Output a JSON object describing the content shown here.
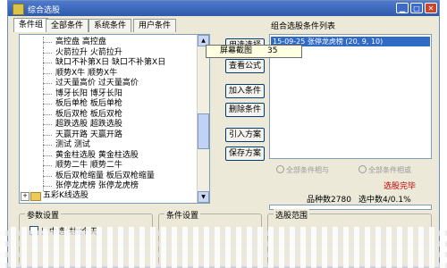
{
  "window": {
    "title": "综合选股"
  },
  "tabs": [
    {
      "label": "条件组",
      "active": true
    },
    {
      "label": "全部条件",
      "active": false
    },
    {
      "label": "系统条件",
      "active": false
    },
    {
      "label": "用户条件",
      "active": false
    }
  ],
  "tree": {
    "items": [
      {
        "label": "高控盘  高控盘"
      },
      {
        "label": "火箭拉升  火箭拉升"
      },
      {
        "label": "缺口不补第X日  缺口不补第X日"
      },
      {
        "label": "顺势X牛  顺势X牛"
      },
      {
        "label": "过天量高价  过天量高价"
      },
      {
        "label": "博牙长阳  博牙长阳"
      },
      {
        "label": "板后单枪  板后单枪"
      },
      {
        "label": "板后双枪  板后双枪"
      },
      {
        "label": "超跌选股  超跌选股"
      },
      {
        "label": "天赢开路  天赢开路"
      },
      {
        "label": "测试  测试"
      },
      {
        "label": "黄金柱选股  黄金柱选股"
      },
      {
        "label": "顺势二牛  顺势二牛"
      },
      {
        "label": "板后双枪缩量  板后双枪缩量"
      },
      {
        "label": "张停龙虎榜  张停龙虎榜"
      }
    ],
    "folder": {
      "label": "五彩K线选股"
    }
  },
  "buttons": {
    "select": "用选选择",
    "view_formula": "查看公式",
    "add_condition": "加入条件",
    "delete_condition": "删除条件",
    "import_scheme": "引入方案",
    "save_scheme": "保存方案"
  },
  "tooltip": {
    "label": "屏幕截图",
    "value": "35"
  },
  "list": {
    "title": "组合选股条件列表",
    "items": [
      "15-09-25  张停龙虎榜  (20, 9, 10)"
    ]
  },
  "radios": {
    "and": "全部条件相与",
    "or": "全部条件相或"
  },
  "status": {
    "running": "选股完毕",
    "count_label": "品种数",
    "count_value": "2780",
    "ratio_label": "选中数",
    "ratio_value": "4/0.1%"
  },
  "groups": {
    "params": "参数设置",
    "conditions": "条件设置",
    "scope": "选股范围"
  },
  "options": {
    "current_only": "只中选供数个天"
  },
  "colors": {
    "selection": "#316ac5",
    "status_red": "#c00000",
    "titlebar": "#2f5aa8"
  },
  "icons": {
    "app": "app-icon",
    "folder": "folder-icon",
    "expand": "plus-icon"
  }
}
